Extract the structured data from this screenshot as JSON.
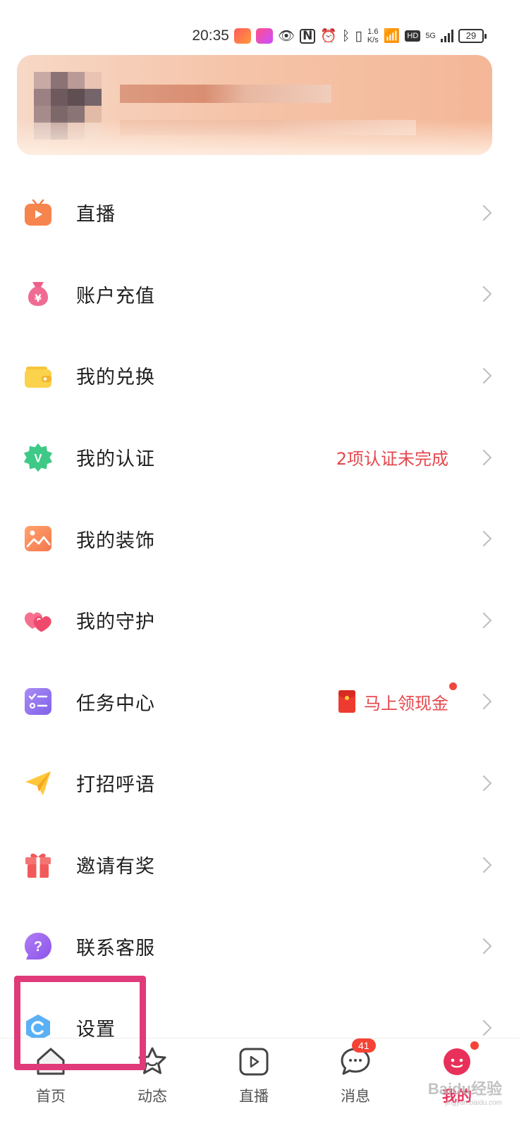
{
  "status_bar": {
    "time": "20:35",
    "net_speed_value": "1.6",
    "net_speed_unit": "K/s",
    "hd_label": "HD",
    "network_type": "5G",
    "battery": "29",
    "icons": [
      "eye-icon",
      "nfc-icon",
      "alarm-icon",
      "bluetooth-icon",
      "vibrate-icon",
      "wifi-icon",
      "signal-icon",
      "battery-icon"
    ]
  },
  "menu": {
    "items": [
      {
        "label": "直播",
        "icon": "live-tv-icon"
      },
      {
        "label": "账户充值",
        "icon": "money-bag-icon"
      },
      {
        "label": "我的兑换",
        "icon": "wallet-icon"
      },
      {
        "label": "我的认证",
        "icon": "verify-badge-icon",
        "extra": "2项认证未完成"
      },
      {
        "label": "我的装饰",
        "icon": "picture-icon"
      },
      {
        "label": "我的守护",
        "icon": "hearts-icon"
      },
      {
        "label": "任务中心",
        "icon": "task-list-icon",
        "extra": "马上领现金"
      },
      {
        "label": "打招呼语",
        "icon": "paper-plane-icon"
      },
      {
        "label": "邀请有奖",
        "icon": "gift-icon"
      },
      {
        "label": "联系客服",
        "icon": "question-bubble-icon"
      },
      {
        "label": "设置",
        "icon": "settings-icon"
      }
    ]
  },
  "tab_bar": {
    "tabs": [
      {
        "label": "首页",
        "icon": "home-icon"
      },
      {
        "label": "动态",
        "icon": "moments-icon"
      },
      {
        "label": "直播",
        "icon": "live-play-icon"
      },
      {
        "label": "消息",
        "icon": "message-icon",
        "badge": "41"
      },
      {
        "label": "我的",
        "icon": "profile-icon",
        "active": true
      }
    ]
  },
  "watermark": {
    "text": "Baidu经验",
    "sub": "jingyan.baidu.com"
  },
  "colors": {
    "accent": "#e8315a",
    "highlight": "#e03a7a",
    "warning_text": "#e5484d"
  }
}
